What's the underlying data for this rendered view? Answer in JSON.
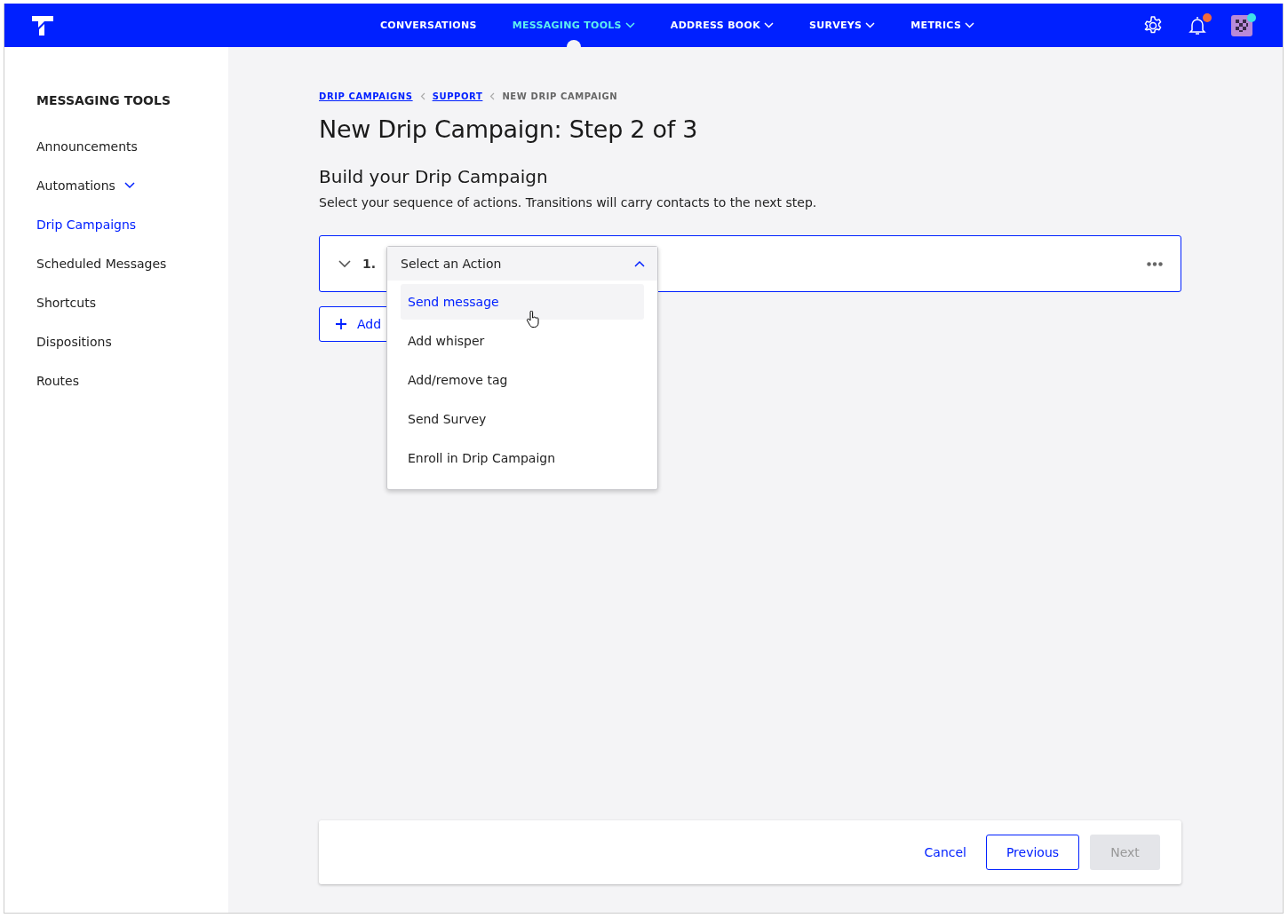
{
  "nav": {
    "items": [
      {
        "label": "CONVERSATIONS",
        "dropdown": false,
        "selected": false
      },
      {
        "label": "MESSAGING TOOLS",
        "dropdown": true,
        "selected": true
      },
      {
        "label": "ADDRESS BOOK",
        "dropdown": true,
        "selected": false
      },
      {
        "label": "SURVEYS",
        "dropdown": true,
        "selected": false
      },
      {
        "label": "METRICS",
        "dropdown": true,
        "selected": false
      }
    ],
    "notifications": {
      "unread": true
    },
    "avatar": {
      "online": true
    }
  },
  "sidebar": {
    "title": "MESSAGING TOOLS",
    "items": [
      {
        "label": "Announcements",
        "expandable": false,
        "selected": false
      },
      {
        "label": "Automations",
        "expandable": true,
        "selected": false
      },
      {
        "label": "Drip Campaigns",
        "expandable": false,
        "selected": true
      },
      {
        "label": "Scheduled Messages",
        "expandable": false,
        "selected": false
      },
      {
        "label": "Shortcuts",
        "expandable": false,
        "selected": false
      },
      {
        "label": "Dispositions",
        "expandable": false,
        "selected": false
      },
      {
        "label": "Routes",
        "expandable": false,
        "selected": false
      }
    ]
  },
  "breadcrumbs": [
    {
      "label": "DRIP CAMPAIGNS",
      "link": true
    },
    {
      "label": "SUPPORT",
      "link": true
    },
    {
      "label": "NEW DRIP CAMPAIGN",
      "link": false
    }
  ],
  "title": "New Drip Campaign: Step 2 of 3",
  "section": {
    "heading": "Build your Drip Campaign",
    "description": "Select your sequence of actions. Transitions will carry contacts to the next step."
  },
  "steps": [
    {
      "number": "1.",
      "expanded": true,
      "select": {
        "placeholder": "Select an Action",
        "open": true,
        "options": [
          {
            "label": "Send message",
            "selected": true
          },
          {
            "label": "Add whisper",
            "selected": false
          },
          {
            "label": "Add/remove tag",
            "selected": false
          },
          {
            "label": "Send Survey",
            "selected": false
          },
          {
            "label": "Enroll in Drip Campaign",
            "selected": false
          }
        ]
      }
    }
  ],
  "add_step_button": "Add",
  "footer": {
    "cancel": "Cancel",
    "previous": "Previous",
    "next": {
      "label": "Next",
      "disabled": true
    }
  }
}
